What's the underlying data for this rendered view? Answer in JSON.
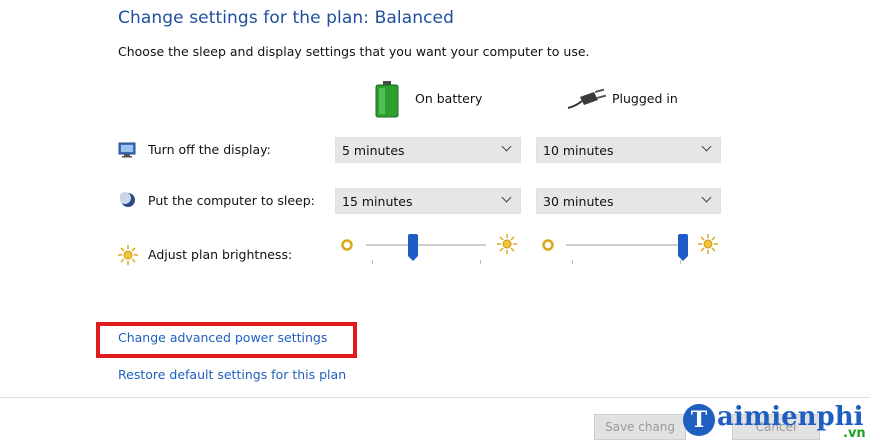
{
  "header": {
    "title": "Change settings for the plan: Balanced",
    "subtitle": "Choose the sleep and display settings that you want your computer to use."
  },
  "columns": {
    "battery_label": "On battery",
    "plugged_label": "Plugged in"
  },
  "rows": {
    "display": {
      "label": "Turn off the display:",
      "battery": "5 minutes",
      "plugged": "10 minutes"
    },
    "sleep": {
      "label": "Put the computer to sleep:",
      "battery": "15 minutes",
      "plugged": "30 minutes"
    },
    "brightness": {
      "label": "Adjust plan brightness:",
      "battery_level": 0.38,
      "plugged_level": 1.0
    }
  },
  "links": {
    "advanced": "Change advanced power settings",
    "restore": "Restore default settings for this plan"
  },
  "buttons": {
    "save": "Save chang",
    "cancel": "Cancel"
  },
  "watermark": {
    "brand": "aimienphi",
    "initial": "T",
    "suffix": ".vn"
  },
  "colors": {
    "link": "#1f5fbf",
    "highlight": "#e01b1b",
    "slider": "#1e5bc6"
  },
  "icons": {
    "battery": "battery-icon",
    "plug": "plug-icon",
    "display": "display-icon",
    "sleep": "moon-icon",
    "brightness": "sun-icon"
  }
}
